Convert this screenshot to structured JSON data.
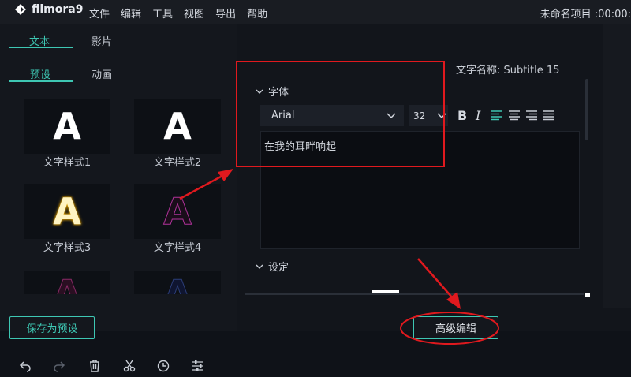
{
  "app": {
    "logo_text": "filmora9",
    "project_title": "未命名项目 :00:00:"
  },
  "menu": [
    "文件",
    "编辑",
    "工具",
    "视图",
    "导出",
    "帮助"
  ],
  "left_panel": {
    "tabs": {
      "text": "文本",
      "film": "影片"
    },
    "subtabs": {
      "preset": "预设",
      "animation": "动画"
    },
    "presets": [
      {
        "label": "文字样式1",
        "glyph": "A"
      },
      {
        "label": "文字样式2",
        "glyph": "A"
      },
      {
        "label": "文字样式3",
        "glyph": "A"
      },
      {
        "label": "文字样式4",
        "glyph": "A"
      },
      {
        "label": "",
        "glyph": "A"
      },
      {
        "label": "",
        "glyph": "A"
      }
    ],
    "save_preset_label": "保存为预设"
  },
  "editor": {
    "name_label": "文字名称:",
    "name_value": "Subtitle 15",
    "font_section": "字体",
    "font_family": "Arial",
    "font_size": "32",
    "bold": "B",
    "italic": "I",
    "text_content": "在我的耳畔响起",
    "settings_section": "设定",
    "advanced_edit_label": "高级编辑"
  },
  "colors": {
    "accent": "#3ec7b3",
    "annotation": "#e0191e"
  },
  "toolbar_icons": [
    "undo-icon",
    "redo-icon",
    "delete-icon",
    "cut-icon",
    "clock-icon",
    "adjust-icon"
  ]
}
